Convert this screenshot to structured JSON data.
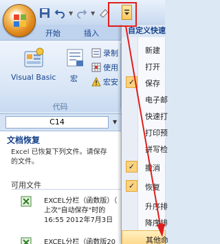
{
  "quick_access": {
    "icons": [
      "office-button",
      "save-icon",
      "undo-icon",
      "redo-icon",
      "eraser-icon",
      "customize-dropdown-icon"
    ]
  },
  "ribbon": {
    "tabs": [
      "开始",
      "插入"
    ],
    "visual_basic_label": "Visual Basic",
    "macro_label": "宏",
    "small_buttons": [
      "录制",
      "使用",
      "宏安"
    ],
    "group_label": "代码"
  },
  "name_box": {
    "value": "C14"
  },
  "recovery": {
    "title": "文档恢复",
    "description_line1": "Excel 已恢复下列文件。请保存",
    "description_line2": "的文件。",
    "available_label": "可用文件",
    "files": [
      {
        "line1": "EXCEL分栏（函数版）（",
        "line2": "上次\"自动保存\"时的",
        "line3": "16:55 2012年7月3日"
      },
      {
        "line1": "EXCEL分栏（函数版20"
      }
    ]
  },
  "menu": {
    "header": "自定义快速",
    "items": [
      {
        "label": "新建",
        "checked": false
      },
      {
        "label": "打开",
        "checked": false
      },
      {
        "label": "保存",
        "checked": true
      },
      {
        "label": "电子邮",
        "checked": false
      },
      {
        "label": "快速打",
        "checked": false
      },
      {
        "label": "打印预",
        "checked": false
      },
      {
        "label": "拼写检",
        "checked": false
      },
      {
        "label": "撤消",
        "checked": true
      },
      {
        "label": "恢复",
        "checked": true
      },
      {
        "label": "升序排",
        "checked": false
      },
      {
        "label": "降序排",
        "checked": false
      },
      {
        "label": "其他命",
        "checked": false
      }
    ]
  },
  "colors": {
    "highlight_red": "#e21b1b",
    "ribbon_blue": "#15428b",
    "check_orange": "#fbd37f"
  }
}
